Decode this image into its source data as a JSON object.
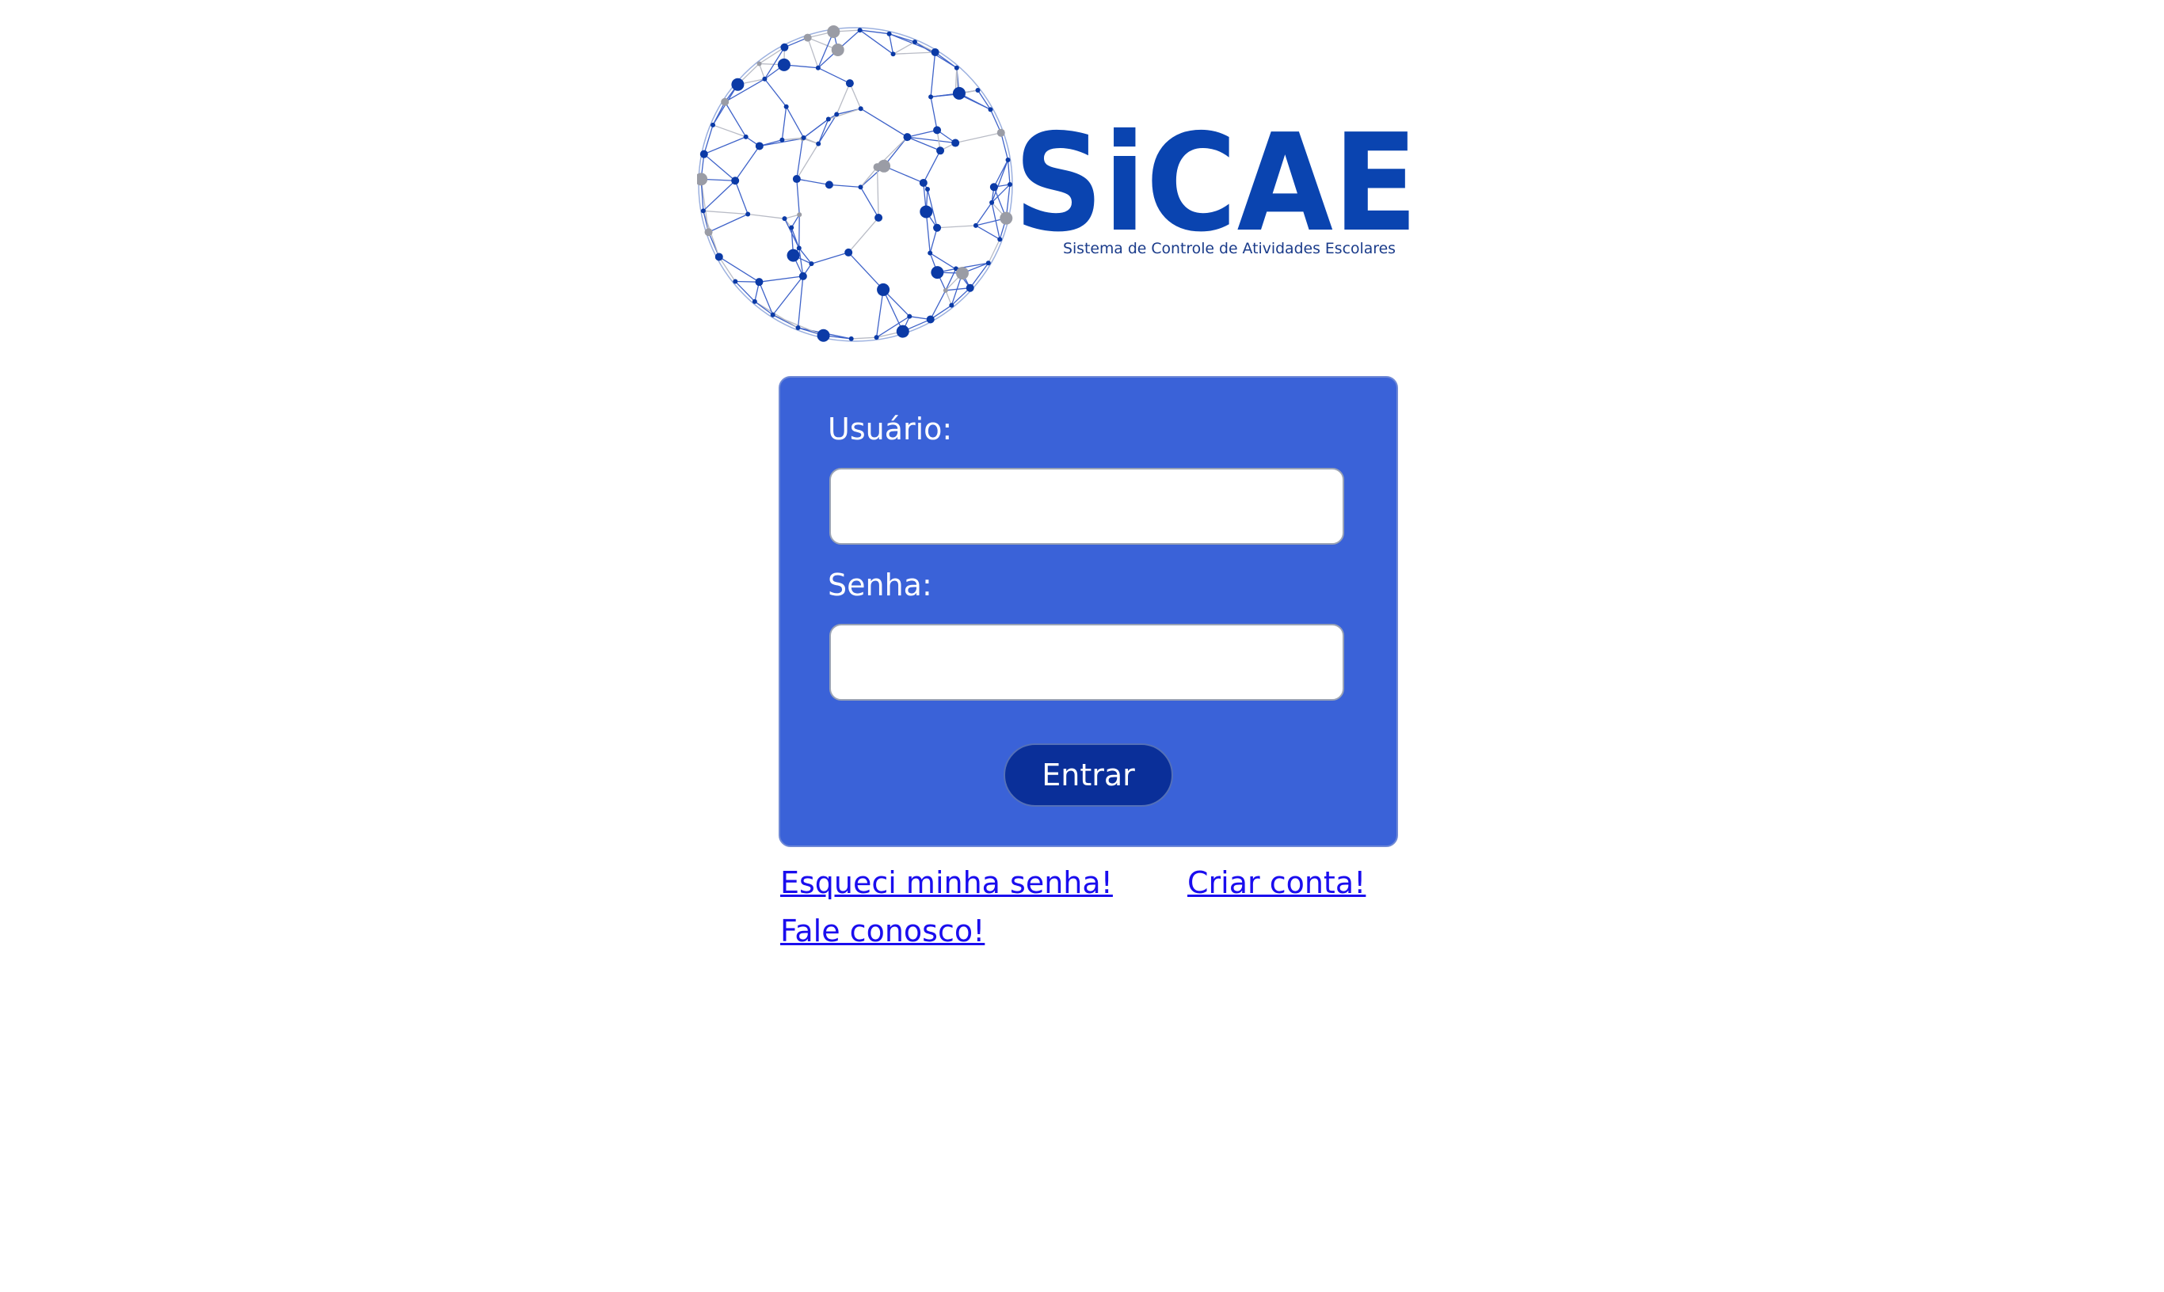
{
  "brand": {
    "name": "SiCAE",
    "tagline": "Sistema de Controle de Atividades Escolares",
    "primary_color": "#0a44b0",
    "globe_icon": "network-globe-icon"
  },
  "login": {
    "user_label": "Usuário:",
    "user_value": "",
    "password_label": "Senha:",
    "password_value": "",
    "submit_label": "Entrar",
    "box_color": "#3a62d8",
    "button_color": "#0a2f99"
  },
  "links": {
    "forgot_password": "Esqueci minha senha!",
    "create_account": "Criar conta!",
    "contact_us": "Fale conosco!",
    "link_color": "#1a0dee"
  }
}
